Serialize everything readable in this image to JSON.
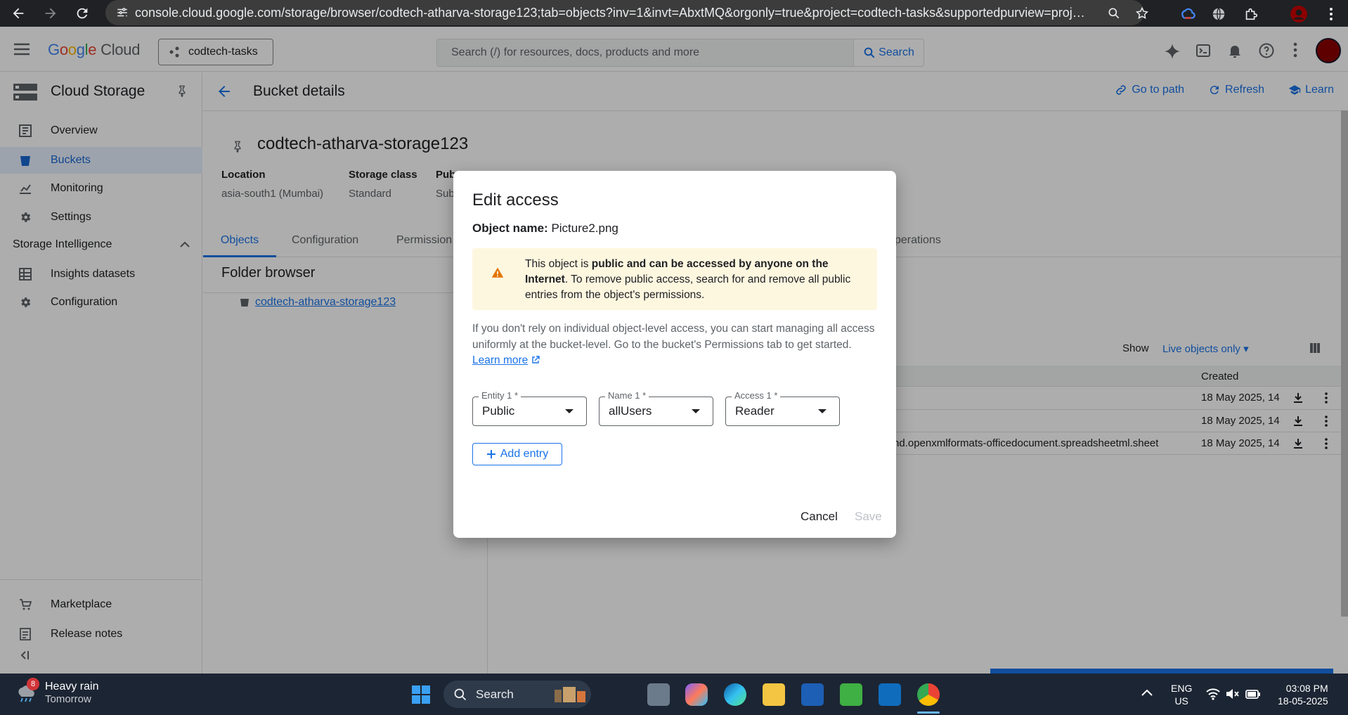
{
  "browser": {
    "url": "console.cloud.google.com/storage/browser/codtech-atharva-storage123;tab=objects?inv=1&invt=AbxtMQ&orgonly=true&project=codtech-tasks&supportedpurview=project..."
  },
  "header": {
    "logo_google_parts": [
      "G",
      "o",
      "o",
      "g",
      "l",
      "e"
    ],
    "logo_cloud": "Cloud",
    "project": "codtech-tasks",
    "search_placeholder": "Search (/) for resources, docs, products and more",
    "search_button": "Search"
  },
  "sidebar": {
    "title": "Cloud Storage",
    "items": [
      {
        "label": "Overview",
        "icon": "overview-icon"
      },
      {
        "label": "Buckets",
        "icon": "bucket-icon",
        "active": true
      },
      {
        "label": "Monitoring",
        "icon": "monitoring-icon"
      },
      {
        "label": "Settings",
        "icon": "gear-icon"
      }
    ],
    "section": "Storage Intelligence",
    "section_items": [
      {
        "label": "Insights datasets",
        "icon": "dataset-icon"
      },
      {
        "label": "Configuration",
        "icon": "gear-icon"
      }
    ],
    "bottom_items": [
      {
        "label": "Marketplace",
        "icon": "cart-icon"
      },
      {
        "label": "Release notes",
        "icon": "notes-icon"
      }
    ]
  },
  "main": {
    "page_title": "Bucket details",
    "links": {
      "go_to_path": "Go to path",
      "refresh": "Refresh",
      "learn": "Learn"
    },
    "bucket_name": "codtech-atharva-storage123",
    "meta": [
      {
        "key": "Location",
        "value": "asia-south1 (Mumbai)"
      },
      {
        "key": "Storage class",
        "value": "Standard"
      },
      {
        "key": "Pub",
        "value": "Sub"
      }
    ],
    "tabs": [
      "Objects",
      "Configuration",
      "Permission",
      "Operations"
    ],
    "tab_operations_visible": "perations",
    "folder_browser": "Folder browser",
    "folder_item": "codtech-atharva-storage123",
    "show_label": "Show",
    "show_value": "Live objects only",
    "created_header": "Created",
    "rows": [
      {
        "type": "",
        "created": "18 May 2025, 14"
      },
      {
        "type": "",
        "created": "18 May 2025, 14"
      },
      {
        "type": "nd.openxmlformats-officedocument.spreadsheetml.sheet",
        "created": "18 May 2025, 14"
      }
    ]
  },
  "dialog": {
    "title": "Edit access",
    "object_name_label": "Object name:",
    "object_name": "Picture2.png",
    "warning_pre": "This object is ",
    "warning_bold": "public and can be accessed by anyone on the Internet",
    "warning_post": ". To remove public access, search for and remove all public entries from the object's permissions.",
    "info": "If you don't rely on individual object-level access, you can start managing all access uniformly at the bucket-level. Go to the bucket's Permissions tab to get started.",
    "learn_more": "Learn more",
    "fields": [
      {
        "label": "Entity 1 *",
        "value": "Public"
      },
      {
        "label": "Name 1 *",
        "value": "allUsers"
      },
      {
        "label": "Access 1 *",
        "value": "Reader"
      }
    ],
    "add_entry": "Add entry",
    "cancel": "Cancel",
    "save": "Save"
  },
  "taskbar": {
    "weather_badge": "8",
    "weather": "Heavy rain",
    "weather_sub": "Tomorrow",
    "search": "Search",
    "lang1": "ENG",
    "lang2": "US",
    "time": "03:08 PM",
    "date": "18-05-2025"
  },
  "colors": {
    "accent": "#1a73e8",
    "warning_bg": "#fef7e0",
    "warning_icon": "#e37400"
  }
}
